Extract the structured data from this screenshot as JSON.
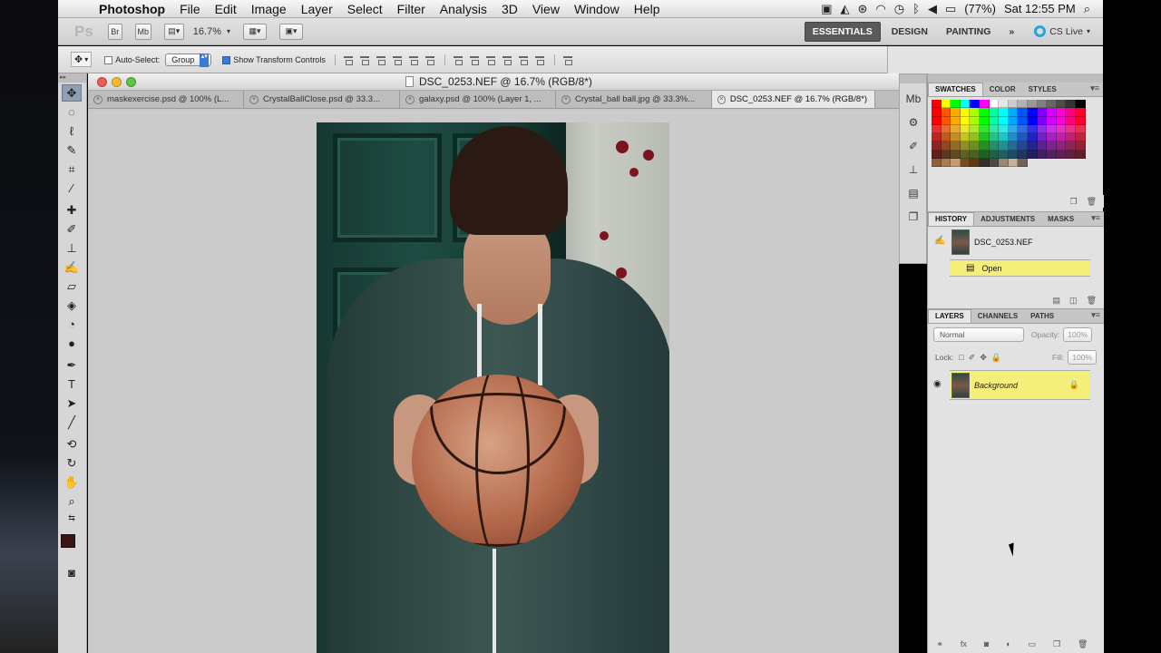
{
  "menubar": {
    "app_name": "Photoshop",
    "items": [
      "File",
      "Edit",
      "Image",
      "Layer",
      "Select",
      "Filter",
      "Analysis",
      "3D",
      "View",
      "Window",
      "Help"
    ],
    "battery": "(77%)",
    "clock": "Sat 12:55 PM"
  },
  "appbar": {
    "zoom": "16.7%",
    "workspaces": [
      "ESSENTIALS",
      "DESIGN",
      "PAINTING"
    ],
    "active_workspace": "ESSENTIALS",
    "overflow": "»",
    "cs_live": "CS Live"
  },
  "options": {
    "auto_select_label": "Auto-Select:",
    "auto_select_checked": false,
    "group_value": "Group",
    "show_transform_label": "Show Transform Controls",
    "show_transform_checked": true
  },
  "document": {
    "window_title": "DSC_0253.NEF @ 16.7% (RGB/8*)",
    "tabs": [
      {
        "label": "maskexercise.psd @ 100% (L...",
        "active": false
      },
      {
        "label": "CrystalBallClose.psd @ 33.3...",
        "active": false
      },
      {
        "label": "galaxy.psd @ 100% (Layer 1, ...",
        "active": false
      },
      {
        "label": "Crystal_ball ball.jpg @ 33.3%...",
        "active": false
      },
      {
        "label": "DSC_0253.NEF @ 16.7% (RGB/8*)",
        "active": true
      }
    ]
  },
  "swatches_panel": {
    "tabs": [
      "SWATCHES",
      "COLOR",
      "STYLES"
    ],
    "active": "SWATCHES"
  },
  "history_panel": {
    "tabs": [
      "HISTORY",
      "ADJUSTMENTS",
      "MASKS"
    ],
    "active": "HISTORY",
    "snapshot": "DSC_0253.NEF",
    "steps": [
      "Open"
    ]
  },
  "layers_panel": {
    "tabs": [
      "LAYERS",
      "CHANNELS",
      "PATHS"
    ],
    "active": "LAYERS",
    "blend_mode": "Normal",
    "opacity_label": "Opacity:",
    "opacity": "100%",
    "lock_label": "Lock:",
    "fill_label": "Fill:",
    "fill": "100%",
    "layers": [
      {
        "name": "Background",
        "locked": true,
        "visible": true
      }
    ]
  },
  "colors": {
    "foreground": "#3d1414",
    "background": "#ffffff",
    "highlight_yellow": "#f4ee7a"
  }
}
